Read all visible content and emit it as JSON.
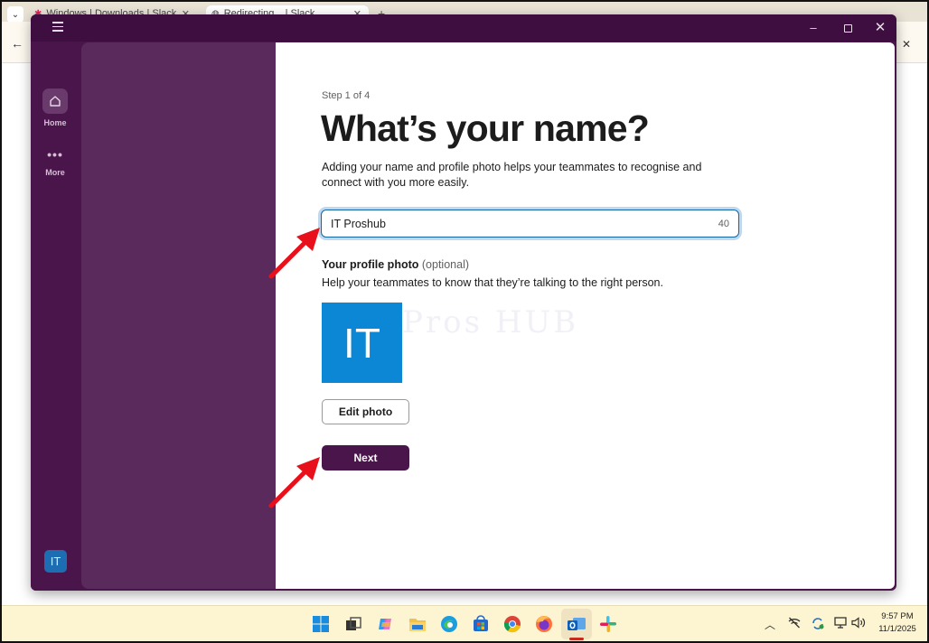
{
  "browser": {
    "tabs": [
      {
        "label": "Windows | Downloads | Slack"
      },
      {
        "label": "Redirecting... | Slack"
      }
    ]
  },
  "rail": {
    "home_label": "Home",
    "more_label": "More",
    "user_initials": "IT"
  },
  "onboarding": {
    "step": "Step 1 of 4",
    "heading": "What’s your name?",
    "description": "Adding your name and profile photo helps your teammates to recognise and connect with you more easily.",
    "name_value": "IT Proshub",
    "name_char_count": "40",
    "photo_label": "Your profile photo",
    "photo_optional": "(optional)",
    "photo_help": "Help your teammates to know that they’re talking to the right person.",
    "avatar_initials": "IT",
    "watermark": "Pros HUB",
    "edit_photo_label": "Edit photo",
    "next_label": "Next"
  },
  "taskbar": {
    "time": "9:57 PM",
    "date": "11/1/2025",
    "apps": [
      "windows-start",
      "file-explorer",
      "copilot",
      "folder",
      "edge",
      "microsoft-store",
      "chrome",
      "firefox",
      "outlook",
      "slack"
    ]
  },
  "colors": {
    "slack_aubergine": "#4a154b",
    "side_panel": "#5b2a5c",
    "focus_blue": "#1264a3",
    "avatar_blue": "#0b87d6",
    "annotation_red": "#e8101a"
  }
}
